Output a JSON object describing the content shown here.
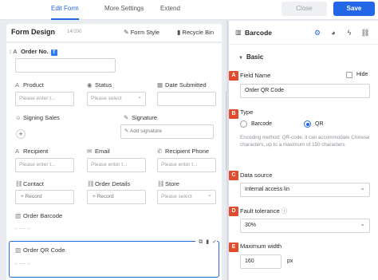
{
  "tabs": [
    {
      "label": "Edit Form"
    },
    {
      "label": "More Settings"
    },
    {
      "label": "Extend"
    }
  ],
  "actions": {
    "close": "Close",
    "save": "Save"
  },
  "design": {
    "title": "Form Design",
    "count": "14/200",
    "form_style": "Form Style",
    "recycle_bin": "Recycle Bin"
  },
  "form": {
    "order_no": "Order No.",
    "order_no_badge": "T",
    "product": "Product",
    "product_placeholder": "Please enter t...",
    "status": "Status",
    "status_placeholder": "Please select",
    "date_submitted": "Date Submitted",
    "signing_sales": "Signing Sales",
    "signature": "Signature",
    "signature_add": "Add signature",
    "recipient": "Recipient",
    "recipient_placeholder": "Please enter t...",
    "email": "Email",
    "email_placeholder": "Please enter t...",
    "recipient_phone": "Recipient Phone",
    "recipient_phone_placeholder": "Please enter t...",
    "contact": "Contact",
    "contact_record": "+ Record",
    "order_details": "Order Details",
    "order_details_record": "+ Record",
    "store": "Store",
    "store_placeholder": "Please select",
    "order_barcode": "Order Barcode",
    "order_qr_code": "Order QR Code"
  },
  "panel": {
    "title": "Barcode",
    "section": "Basic",
    "field_name_label": "Field Name",
    "field_name_value": "Order QR Code",
    "hide": "Hide",
    "type_label": "Type",
    "type_options": [
      "Barcode",
      "QR"
    ],
    "type_selected": "QR",
    "type_help": "Encoding method: QR-code, it can accommodate Chinese characters, up to a maximum of 150 characters",
    "data_source_label": "Data source",
    "data_source_value": "Internal access lin",
    "fault_tolerance_label": "Fault tolerance",
    "fault_tolerance_value": "30%",
    "max_width_label": "Maximum width",
    "max_width_value": "160",
    "max_width_unit": "px",
    "markers": [
      "A",
      "B",
      "C",
      "D",
      "E"
    ]
  },
  "colors": {
    "accent": "#2466e8",
    "marker": "#e24b2b"
  }
}
